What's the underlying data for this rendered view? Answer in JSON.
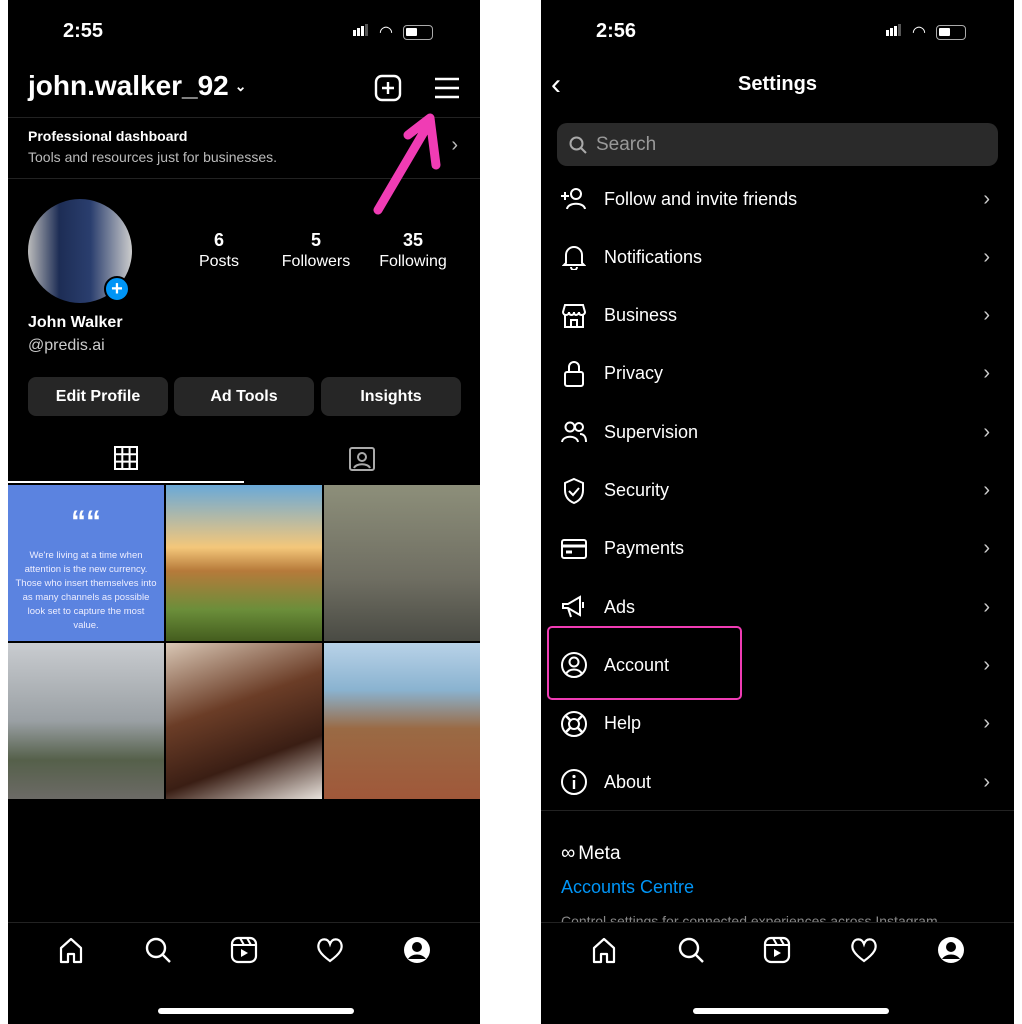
{
  "left": {
    "status_time": "2:55",
    "username": "john.walker_92",
    "icons": [
      "plus-square-icon",
      "menu-icon",
      "chevron-down-icon"
    ],
    "dashboard": {
      "title": "Professional dashboard",
      "subtitle": "Tools and resources just for businesses."
    },
    "stats": [
      {
        "value": "6",
        "label": "Posts"
      },
      {
        "value": "5",
        "label": "Followers"
      },
      {
        "value": "35",
        "label": "Following"
      }
    ],
    "name": "John Walker",
    "handle": "@predis.ai",
    "buttons": [
      "Edit Profile",
      "Ad Tools",
      "Insights"
    ],
    "quote_mark": "““",
    "quote": "We're living at a time when attention is the new currency. Those who insert themselves into as many channels as possible look set to capture the most value.",
    "annotation_color": "#f03cb4"
  },
  "right": {
    "status_time": "2:56",
    "title": "Settings",
    "search_placeholder": "Search",
    "items": [
      "Follow and invite friends",
      "Notifications",
      "Business",
      "Privacy",
      "Supervision",
      "Security",
      "Payments",
      "Ads",
      "Account",
      "Help",
      "About"
    ],
    "highlighted": "Account",
    "meta_label": "Meta",
    "accounts_centre": "Accounts Centre",
    "accounts_centre_desc": "Control settings for connected experiences across Instagram",
    "accent": "#0095f6"
  }
}
